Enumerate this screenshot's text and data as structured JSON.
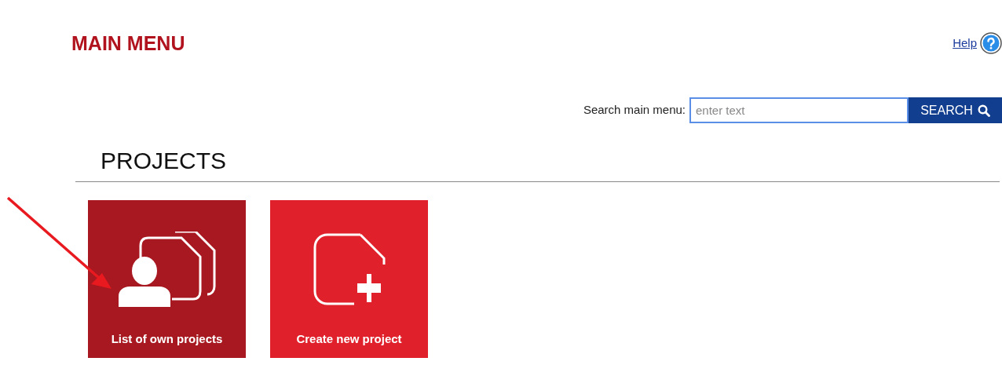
{
  "page": {
    "title": "MAIN MENU",
    "help_link": "Help"
  },
  "search": {
    "label": "Search main menu:",
    "placeholder": "enter text",
    "button": "SEARCH"
  },
  "section": {
    "heading": "PROJECTS"
  },
  "tiles": [
    {
      "label": "List of own projects",
      "kind": "own",
      "selected": true
    },
    {
      "label": "Create new project",
      "kind": "new",
      "selected": false
    }
  ]
}
